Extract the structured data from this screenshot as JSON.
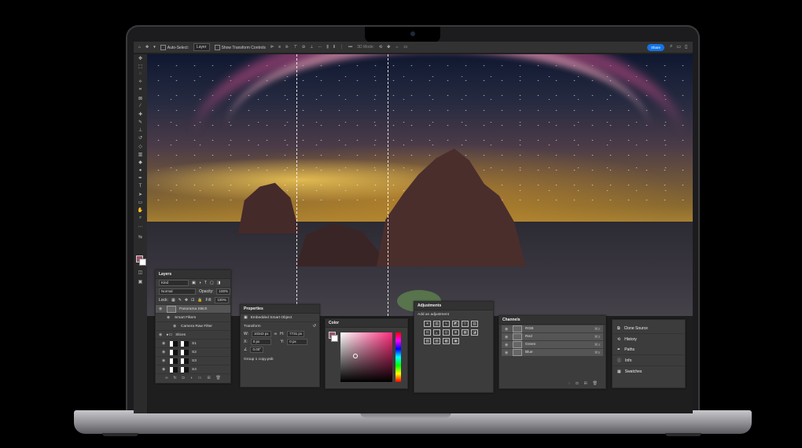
{
  "app": {
    "options_bar": {
      "auto_select_label": "Auto-Select:",
      "auto_select_target": "Layer",
      "show_transform_label": "Show Transform Controls",
      "mode_3d_label": "3D Mode:",
      "share_label": "Share"
    },
    "layers": {
      "title": "Layers",
      "filter_kind": "Kind",
      "blend_mode": "Normal",
      "opacity_label": "Opacity:",
      "opacity_value": "100%",
      "lock_label": "Lock:",
      "fill_label": "Fill:",
      "fill_value": "100%",
      "items": [
        {
          "name": "Panorama Stitch"
        },
        {
          "name": "Smart Filters"
        },
        {
          "name": "Camera Raw Filter"
        },
        {
          "name": "Slices"
        },
        {
          "name": "S1"
        },
        {
          "name": "S2"
        },
        {
          "name": "S3"
        },
        {
          "name": "S4"
        }
      ]
    },
    "properties": {
      "title": "Properties",
      "subtitle": "Embedded Smart Object",
      "section": "Transform",
      "w_label": "W:",
      "w_value": "10343 px",
      "h_label": "H:",
      "h_value": "7731 px",
      "x_label": "X:",
      "x_value": "0 px",
      "y_label": "Y:",
      "y_value": "0 px",
      "angle_value": "0.00°",
      "file_name": "Group 1 copy.psb"
    },
    "color": {
      "title": "Color",
      "foreground": "#9a4f66",
      "hue_color": "#ff2d7c"
    },
    "adjustments": {
      "title": "Adjustments",
      "subtitle": "Add an adjustment"
    },
    "channels": {
      "title": "Channels",
      "items": [
        {
          "name": "RGB",
          "shortcut": "⌘2"
        },
        {
          "name": "Red",
          "shortcut": "⌘3"
        },
        {
          "name": "Green",
          "shortcut": "⌘4"
        },
        {
          "name": "Blue",
          "shortcut": "⌘5"
        }
      ]
    },
    "panel_stack": {
      "items": [
        {
          "name": "Clone Source",
          "icon": "clone-source-icon"
        },
        {
          "name": "History",
          "icon": "history-icon"
        },
        {
          "name": "Paths",
          "icon": "paths-icon"
        },
        {
          "name": "Info",
          "icon": "info-icon"
        },
        {
          "name": "Swatches",
          "icon": "swatches-icon"
        }
      ]
    }
  }
}
